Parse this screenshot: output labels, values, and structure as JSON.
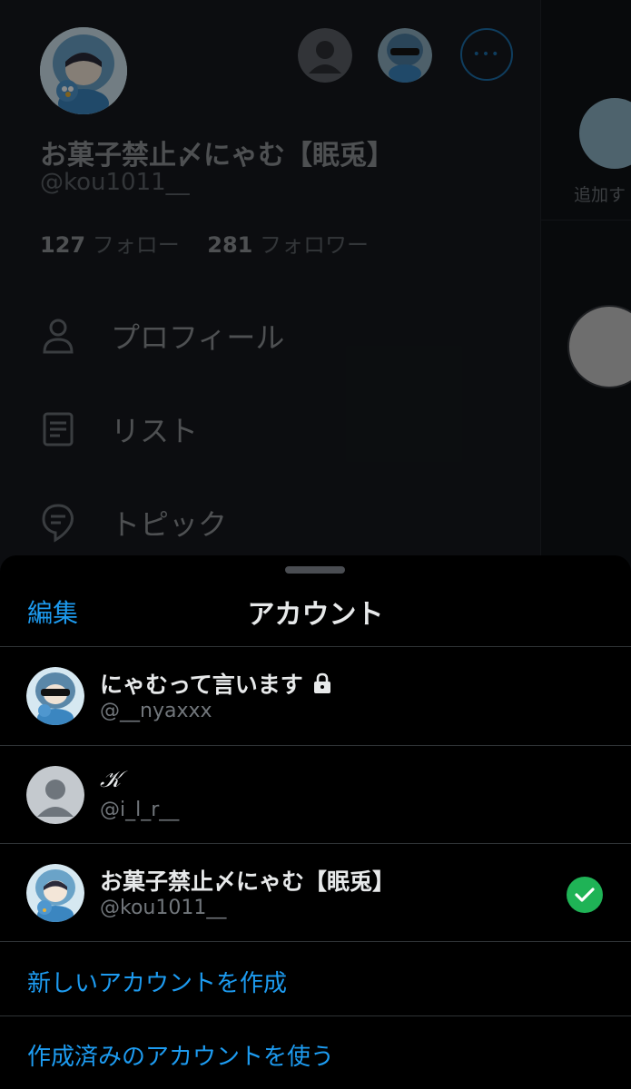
{
  "profile": {
    "display_name": "お菓子禁止〆にゃむ【眠兎】",
    "handle": "@kou1011__",
    "following_count": "127",
    "following_label": "フォロー",
    "followers_count": "281",
    "followers_label": "フォロワー",
    "more_glyph": "•••"
  },
  "menu": {
    "items": [
      {
        "label": "プロフィール",
        "icon": "person-icon"
      },
      {
        "label": "リスト",
        "icon": "list-icon"
      },
      {
        "label": "トピック",
        "icon": "topic-icon"
      }
    ]
  },
  "background_strip": {
    "add_label": "追加す"
  },
  "sheet": {
    "edit_label": "編集",
    "title": "アカウント",
    "accounts": [
      {
        "name": "にゃむって言います",
        "handle": "@__nyaxxx",
        "locked": true,
        "selected": false
      },
      {
        "name": "𝒦",
        "handle": "@i_l_r__",
        "locked": false,
        "selected": false
      },
      {
        "name": "お菓子禁止〆にゃむ【眠兎】",
        "handle": "@kou1011__",
        "locked": false,
        "selected": true
      }
    ],
    "create_account": "新しいアカウントを作成",
    "use_existing": "作成済みのアカウントを使う"
  },
  "colors": {
    "accent": "#1d9bf0",
    "check": "#1fb356",
    "sheet_bg": "#000000"
  }
}
